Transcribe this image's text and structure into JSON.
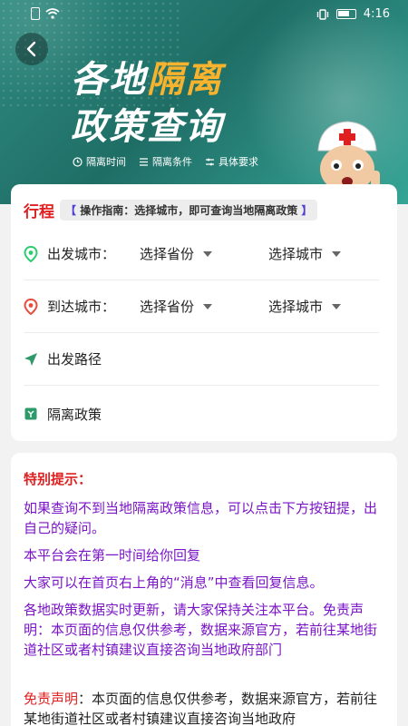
{
  "status_bar": {
    "time": "4:16"
  },
  "banner": {
    "title_line1_a": "各地",
    "title_line1_b": "隔离",
    "title_line2": "政策查询",
    "tags": [
      "隔离时间",
      "隔离条件",
      "具体要求"
    ]
  },
  "trip": {
    "title": "行程",
    "guide_open": "【",
    "guide_text": " 操作指南：选择城市，即可查询当地隔离政策 ",
    "guide_close": "】",
    "departure": {
      "label": "出发城市：",
      "province": "选择省份",
      "city": "选择城市"
    },
    "arrival": {
      "label": "到达城市：",
      "province": "选择省份",
      "city": "选择城市"
    },
    "route_label": "出发路径",
    "policy_label": "隔离政策"
  },
  "notice": {
    "title": "特别提示：",
    "p1": "如果查询不到当地隔离政策信息，可以点击下方按钮提，出自己的疑问。",
    "p2": "本平台会在第一时间给你回复",
    "p3": "大家可以在首页右上角的“消息”中查看回复信息。",
    "p4": "各地政策数据实时更新，请大家保持关注本平台。免责声明：本页面的信息仅供参考，数据来源官方，若前往某地街道社区或者村镇建议直接咨询当地政府部门",
    "disclaimer_label": "免责声明",
    "disclaimer_text": "：本页面的信息仅供参考，数据来源官方，若前往某地街道社区或者村镇建议直接咨询当地政府"
  },
  "colors": {
    "accent_red": "#e02020",
    "purple": "#7a14c7",
    "teal": "#2e8a7f",
    "orange": "#f7b22e"
  }
}
